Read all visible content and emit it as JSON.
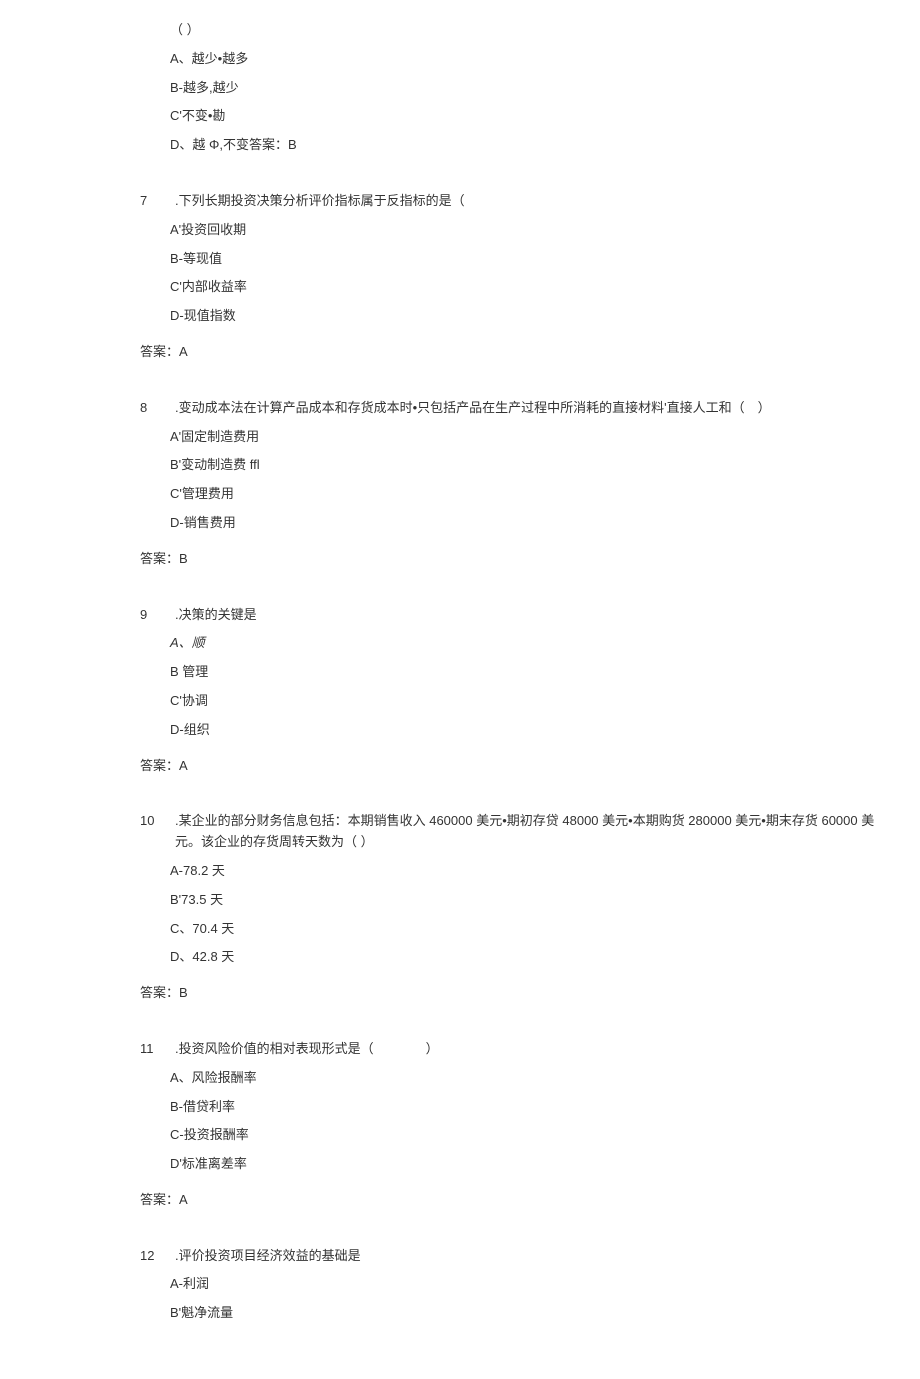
{
  "q6_partial": {
    "stem_placeholder": "（ ）",
    "options": {
      "a": "A、越少•越多",
      "b": "B-越多,越少",
      "c": "C'不变•勘",
      "d": "D、越 Φ,不变答案：B"
    }
  },
  "q7": {
    "num": "7",
    "text": ".下列长期投资决策分析评价指标属于反指标的是（",
    "options": {
      "a": "A'投资回收期",
      "b": "B-等现值",
      "c": "C'内部收益率",
      "d": "D-现值指数"
    },
    "answer": "答案：A"
  },
  "q8": {
    "num": "8",
    "text": ".变动成本法在计算产品成本和存货成本时•只包括产品在生产过程中所消耗的直接材料'直接人工和（　）",
    "options": {
      "a": "A'固定制造费用",
      "b": "B'变动制造费 ffl",
      "c": "C'管理费用",
      "d": "D-销售费用"
    },
    "answer": "答案：B"
  },
  "q9": {
    "num": "9",
    "text": ".决策的关键是",
    "options": {
      "a": "A、顺",
      "b": "B 管理",
      "c": "C'协调",
      "d": "D-组织"
    },
    "answer": "答案：A"
  },
  "q10": {
    "num": "10",
    "text": ".某企业的部分财务信息包括：本期销售收入 460000 美元•期初存贷 48000 美元•本期购货 280000 美元•期末存货 60000 美元。该企业的存货周转天数为（ ）",
    "options": {
      "a": "A-78.2 天",
      "b": "B'73.5 天",
      "c": "C、70.4 天",
      "d": "D、42.8 天"
    },
    "answer": "答案：B"
  },
  "q11": {
    "num": "11",
    "text": ".投资风险价值的相对表现形式是（　　　　）",
    "options": {
      "a": "A、风险报酬率",
      "b": "B-借贷利率",
      "c": "C-投资报酬率",
      "d": "D'标准离差率"
    },
    "answer": "答案：A"
  },
  "q12": {
    "num": "12",
    "text": ".评价投资项目经济效益的基础是",
    "options": {
      "a": "A-利润",
      "b": "B'魁净流量"
    }
  }
}
